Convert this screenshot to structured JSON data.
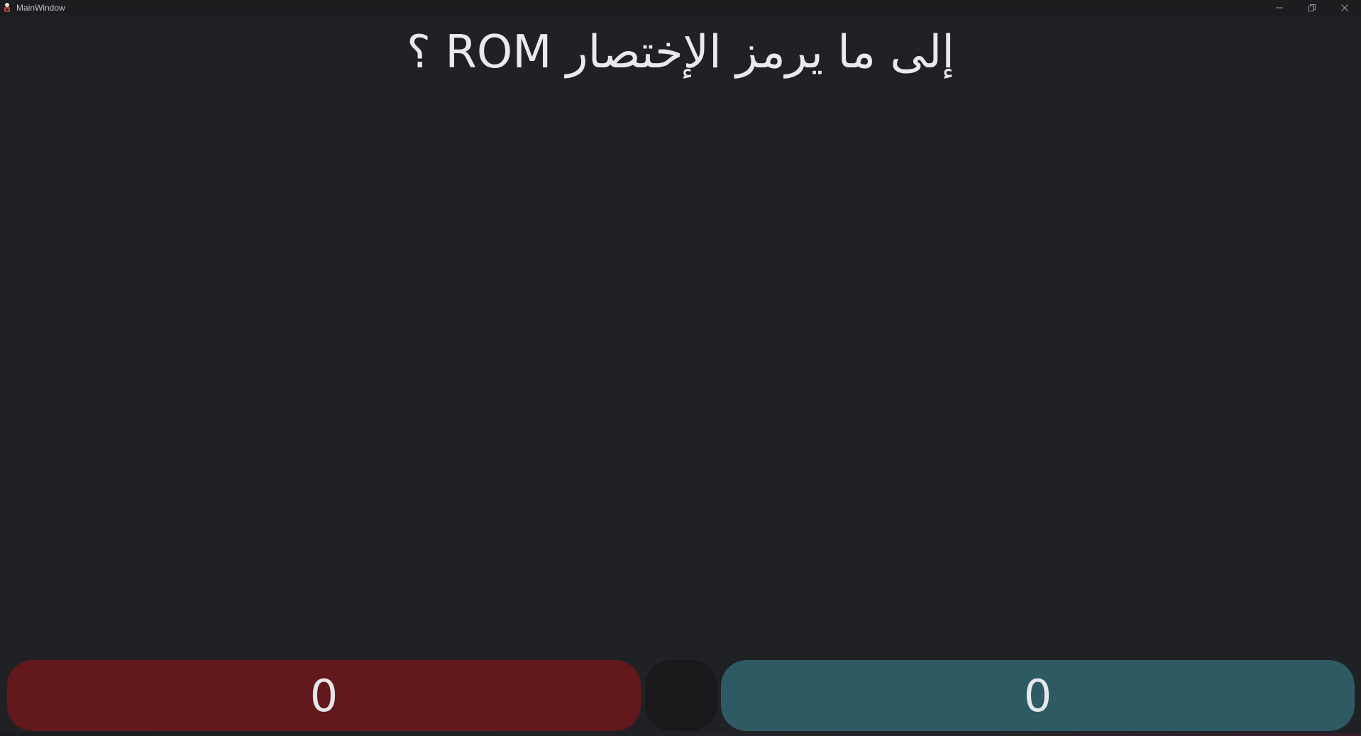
{
  "window": {
    "title": "MainWindow"
  },
  "question": {
    "text": "إلى ما يرمز الإختصار ROM ؟"
  },
  "scores": {
    "left_value": "0",
    "right_value": "0"
  },
  "colors": {
    "background": "#202125",
    "left_team": "#63181c",
    "right_team": "#2d5a63",
    "center": "#19191b"
  },
  "icons": {
    "app": "app-icon",
    "minimize": "minimize-icon",
    "maximize": "restore-icon",
    "close": "close-icon"
  }
}
